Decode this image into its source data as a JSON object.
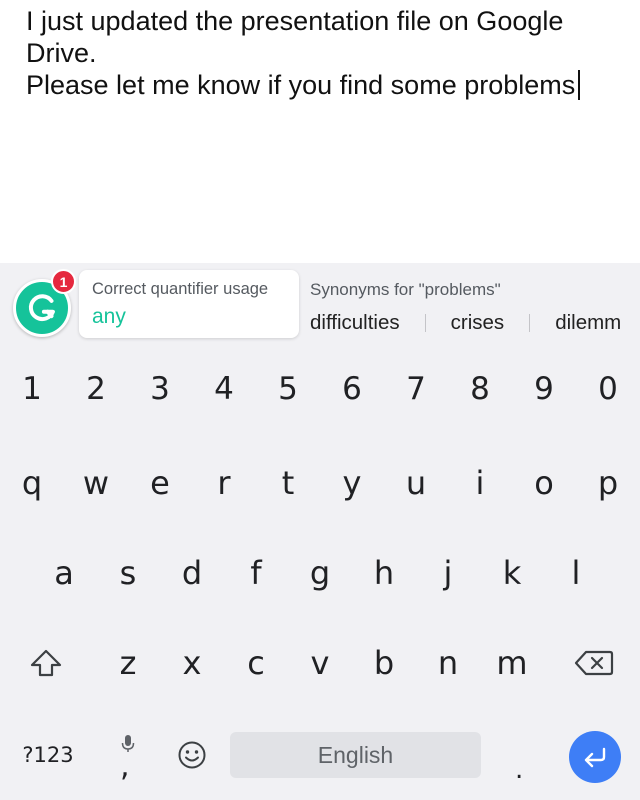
{
  "editor": {
    "lines": [
      "I just updated the presentation file on Google",
      "Drive.",
      "Please let me know if you find some problems"
    ]
  },
  "grammarly": {
    "logo_letter": "G",
    "badge_count": "1",
    "logo_color": "#15c39a",
    "badge_color": "#e5283e",
    "suggestion_title": "Correct quantifier usage",
    "suggestion_value": "any",
    "synonyms_title": "Synonyms for \"problems\"",
    "synonyms": [
      "difficulties",
      "crises",
      "dilemm"
    ]
  },
  "keyboard": {
    "number_row": [
      "1",
      "2",
      "3",
      "4",
      "5",
      "6",
      "7",
      "8",
      "9",
      "0"
    ],
    "row1": [
      "q",
      "w",
      "e",
      "r",
      "t",
      "y",
      "u",
      "i",
      "o",
      "p"
    ],
    "row2": [
      "a",
      "s",
      "d",
      "f",
      "g",
      "h",
      "j",
      "k",
      "l"
    ],
    "row3": [
      "z",
      "x",
      "c",
      "v",
      "b",
      "n",
      "m"
    ],
    "symbols_label": "?123",
    "comma": ",",
    "space_label": "English",
    "period": ".",
    "icons": {
      "shift": "shift-icon",
      "backspace": "backspace-icon",
      "mic": "microphone-icon",
      "emoji": "emoji-icon",
      "enter": "enter-icon"
    },
    "enter_color": "#3e7ef6"
  }
}
